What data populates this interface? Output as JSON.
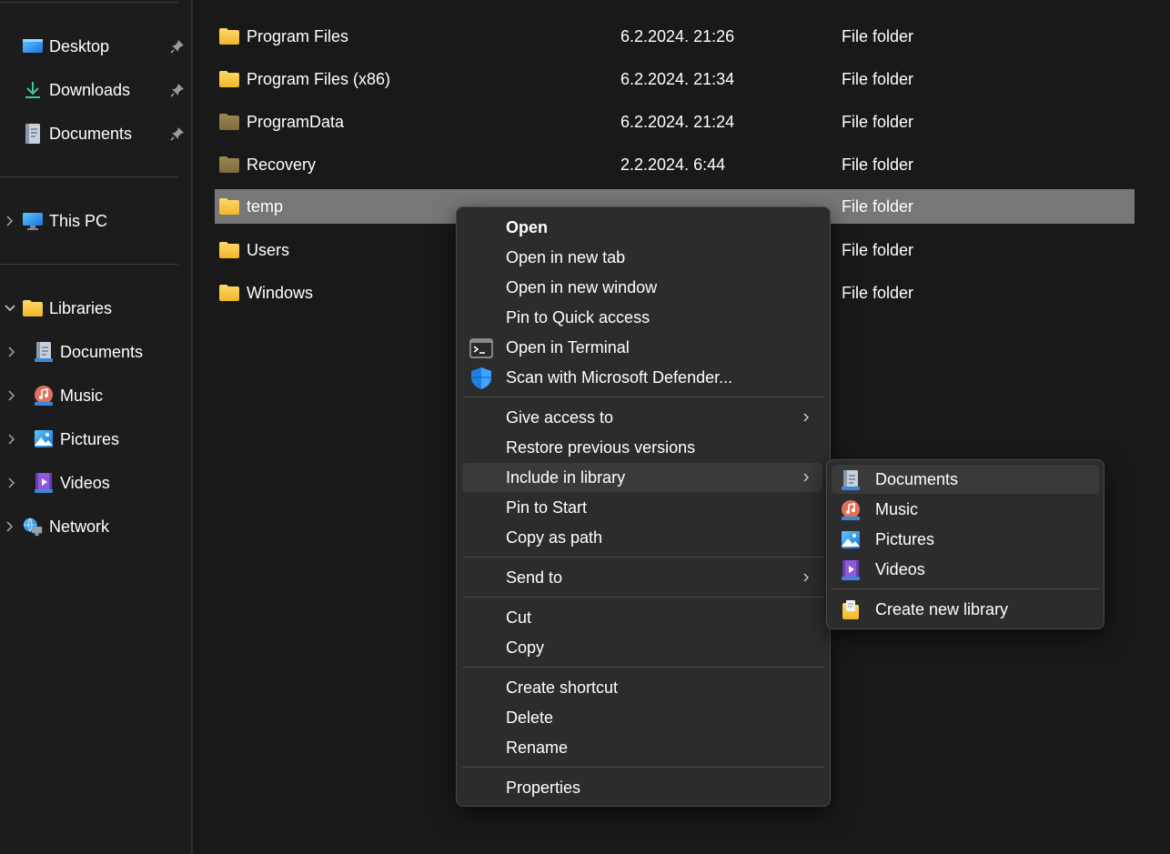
{
  "sidebar": {
    "quick_access": [
      {
        "label": "Desktop",
        "icon": "desktop-icon",
        "pinned": true
      },
      {
        "label": "Downloads",
        "icon": "downloads-icon",
        "pinned": true
      },
      {
        "label": "Documents",
        "icon": "documents-icon",
        "pinned": true
      }
    ],
    "this_pc": {
      "label": "This PC",
      "icon": "this-pc-icon"
    },
    "libraries": {
      "label": "Libraries",
      "icon": "libraries-folder-icon",
      "expanded": true,
      "children": [
        {
          "label": "Documents",
          "icon": "documents-icon"
        },
        {
          "label": "Music",
          "icon": "music-icon"
        },
        {
          "label": "Pictures",
          "icon": "pictures-icon"
        },
        {
          "label": "Videos",
          "icon": "videos-icon"
        }
      ]
    },
    "network": {
      "label": "Network",
      "icon": "network-icon"
    }
  },
  "files": [
    {
      "name": "Program Files",
      "date": "6.2.2024. 21:26",
      "type": "File folder",
      "icon": "folder-icon"
    },
    {
      "name": "Program Files (x86)",
      "date": "6.2.2024. 21:34",
      "type": "File folder",
      "icon": "folder-icon"
    },
    {
      "name": "ProgramData",
      "date": "6.2.2024. 21:24",
      "type": "File folder",
      "icon": "folder-hidden-icon"
    },
    {
      "name": "Recovery",
      "date": "2.2.2024. 6:44",
      "type": "File folder",
      "icon": "folder-hidden-icon"
    },
    {
      "name": "temp",
      "date": "",
      "type": "File folder",
      "icon": "folder-icon",
      "selected": true
    },
    {
      "name": "Users",
      "date": "",
      "type": "File folder",
      "icon": "folder-icon"
    },
    {
      "name": "Windows",
      "date": "",
      "type": "File folder",
      "icon": "folder-icon"
    }
  ],
  "context_menu": {
    "items": [
      {
        "label": "Open",
        "bold": true
      },
      {
        "label": "Open in new tab"
      },
      {
        "label": "Open in new window"
      },
      {
        "label": "Pin to Quick access"
      },
      {
        "label": "Open in Terminal",
        "icon": "terminal-icon"
      },
      {
        "label": "Scan with Microsoft Defender...",
        "icon": "defender-shield-icon"
      },
      {
        "label": "Give access to",
        "submenu": true
      },
      {
        "label": "Restore previous versions"
      },
      {
        "label": "Include in library",
        "submenu": true,
        "highlighted": true
      },
      {
        "label": "Pin to Start"
      },
      {
        "label": "Copy as path"
      },
      {
        "label": "Send to",
        "submenu": true
      },
      {
        "label": "Cut"
      },
      {
        "label": "Copy"
      },
      {
        "label": "Create shortcut"
      },
      {
        "label": "Delete"
      },
      {
        "label": "Rename"
      },
      {
        "label": "Properties"
      }
    ]
  },
  "library_submenu": {
    "items": [
      {
        "label": "Documents",
        "icon": "documents-icon",
        "highlighted": true
      },
      {
        "label": "Music",
        "icon": "music-icon"
      },
      {
        "label": "Pictures",
        "icon": "pictures-icon"
      },
      {
        "label": "Videos",
        "icon": "videos-icon"
      },
      {
        "label": "Create new library",
        "icon": "new-library-icon"
      }
    ]
  },
  "colors": {
    "background": "#191919",
    "menu_background": "#2c2c2c",
    "selected_row": "#777777",
    "folder_yellow": "#f8c74a",
    "accent_blue": "#2b8ae6"
  }
}
